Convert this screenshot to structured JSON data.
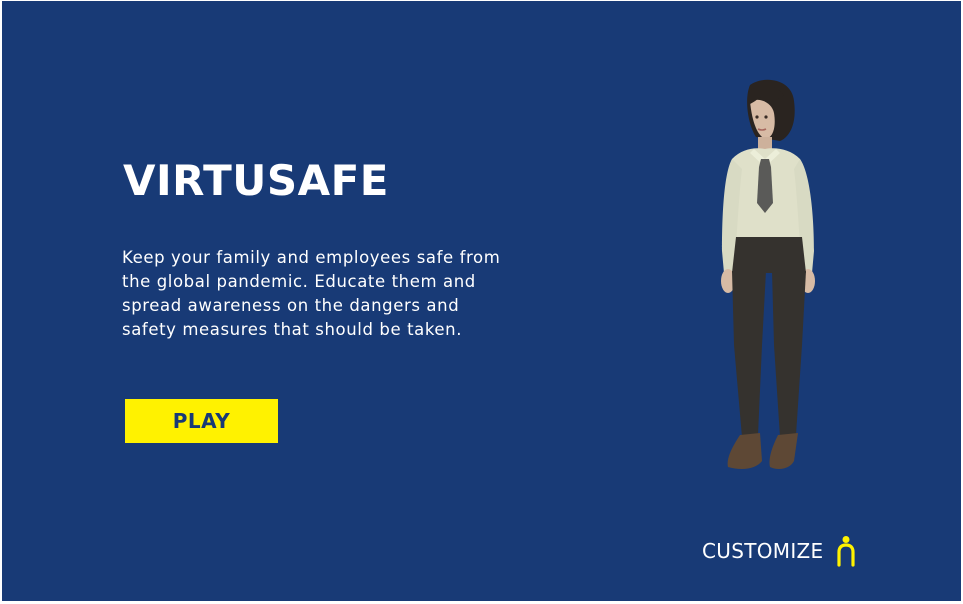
{
  "menu": {
    "title": "VIRTUSAFE",
    "description": "Keep your family and employees safe from the global pandemic. Educate them and spread awareness on the dangers and safety measures that should be taken.",
    "play_label": "PLAY",
    "customize_label": "CUSTOMIZE"
  },
  "icons": {
    "customize": "person-icon",
    "character": "character-avatar"
  },
  "colors": {
    "background": "#183a76",
    "accent": "#fff200",
    "text": "#ffffff"
  }
}
